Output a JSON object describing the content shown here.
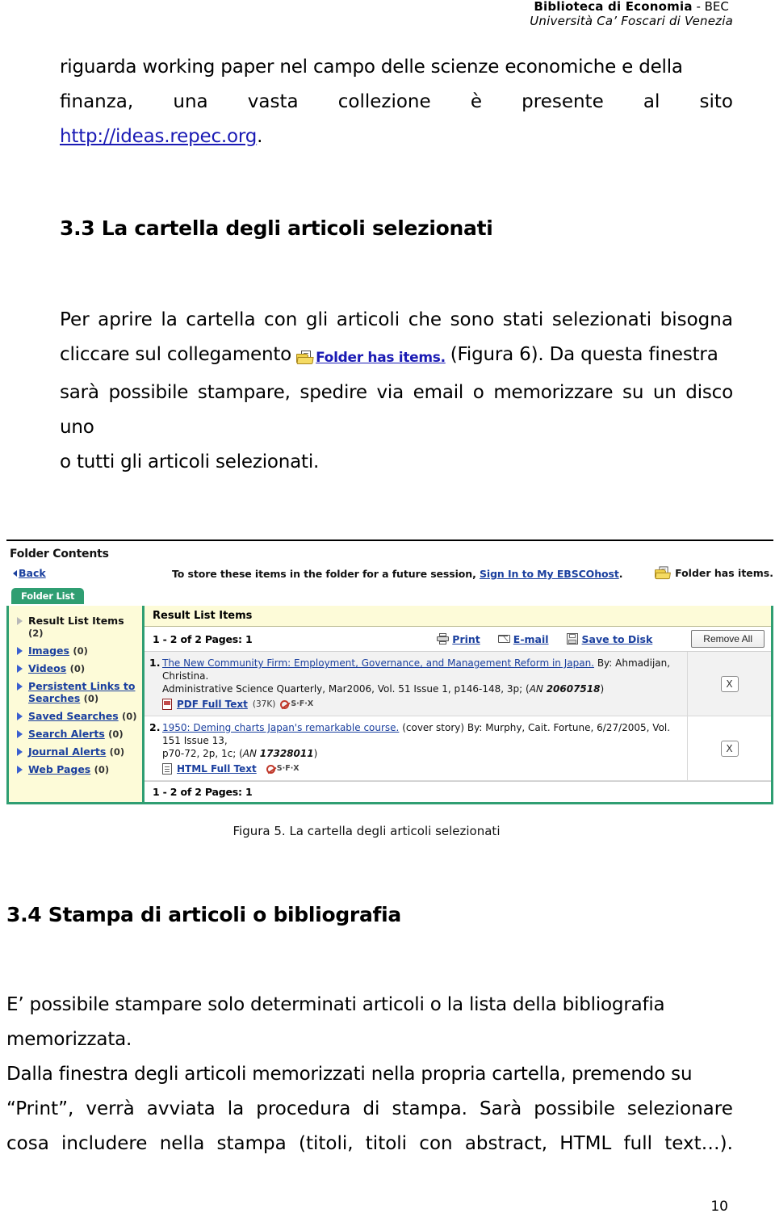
{
  "header": {
    "line1_bold": "Biblioteca di Economia",
    "line1_rest": " -  BEC",
    "line2": "Università Ca’ Foscari di Venezia"
  },
  "intro": {
    "line1": "riguarda working paper nel campo delle scienze economiche e della",
    "line2_words": [
      "finanza,",
      "una",
      "vasta",
      "collezione",
      "è",
      "presente",
      "al",
      "sito"
    ],
    "url_text": "http://ideas.repec.org",
    "url_period": "."
  },
  "section_33": {
    "heading": "3.3 La cartella degli articoli selezionati",
    "para1_before": "Per aprire la cartella con gli articoli che sono stati selezionati bisogna",
    "para1_words": [
      "Per",
      "aprire",
      "la",
      "cartella",
      "con",
      "gli",
      "articoli",
      "che",
      "sono",
      "stati",
      "selezionati",
      "bisogna"
    ],
    "para2_lead": "cliccare sul collegamento",
    "chip_label": "Folder has items.",
    "para2_tail": "(Figura 6). Da questa finestra",
    "para3": "sarà possibile stampare, spedire via email o memorizzare su un disco uno",
    "para4": "o tutti gli articoli selezionati."
  },
  "screenshot": {
    "title": "Folder Contents",
    "back_label": "Back",
    "store_note_prefix": "To store these items in the folder for a future session, ",
    "store_note_link": "Sign In to My EBSCOhost",
    "store_note_suffix": ".",
    "folder_has_items": "Folder has items.",
    "tab_label": "Folder List",
    "sidebar_items": [
      {
        "label": "Result List Items",
        "count": "(2)",
        "active": true
      },
      {
        "label": "Images",
        "count": "(0)",
        "active": false
      },
      {
        "label": "Videos",
        "count": "(0)",
        "active": false
      },
      {
        "label": "Persistent Links to Searches",
        "count": "(0)",
        "active": false
      },
      {
        "label": "Saved Searches",
        "count": "(0)",
        "active": false
      },
      {
        "label": "Search Alerts",
        "count": "(0)",
        "active": false
      },
      {
        "label": "Journal Alerts",
        "count": "(0)",
        "active": false
      },
      {
        "label": "Web Pages",
        "count": "(0)",
        "active": false
      }
    ],
    "panel_title": "Result List Items",
    "pager_top": "1 - 2 of 2  Pages: 1",
    "pager_bottom": "1 - 2 of 2  Pages: 1",
    "tool_print": "Print",
    "tool_email": "E-mail",
    "tool_save": "Save to Disk",
    "btn_remove_all": "Remove All",
    "records": [
      {
        "num": "1.",
        "title": "The New Community Firm: Employment, Governance, and Management Reform in Japan.",
        "author": "By: Ahmadijan, Christina.",
        "source": "Administrative Science Quarterly, Mar2006, Vol. 51 Issue 1, p146-148, 3p; (",
        "an_prefix": "AN ",
        "an_value": "20607518",
        "an_suffix": ")",
        "fulltext_label": "PDF Full Text",
        "fulltext_size": "(37K)",
        "sfx_label": "S·F·X",
        "remove_label": "X"
      },
      {
        "num": "2.",
        "title": "1950: Deming charts Japan's remarkable course.",
        "author": "(cover story) By: Murphy, Cait. Fortune, 6/27/2005, Vol. 151 Issue 13,",
        "source": "p70-72, 2p, 1c; (",
        "an_prefix": "AN ",
        "an_value": "17328011",
        "an_suffix": ")",
        "fulltext_label": "HTML Full Text",
        "fulltext_size": "",
        "sfx_label": "S·F·X",
        "remove_label": "X"
      }
    ]
  },
  "figure_caption": "Figura 5. La cartella degli articoli selezionati",
  "section_34": {
    "heading": "3.4 Stampa di articoli o bibliografia",
    "para1": "E’ possibile stampare solo determinati articoli o la lista della bibliografia",
    "para2": "memorizzata.",
    "para3": "Dalla finestra degli articoli memorizzati nella propria cartella, premendo su",
    "para4_words": [
      "“Print”,",
      "verrà",
      "avviata",
      "la",
      "procedura",
      "di",
      "stampa.",
      "Sarà",
      "possibile",
      "selezionare"
    ],
    "para5_words": [
      "cosa",
      "includere",
      "nella",
      "stampa",
      "(titoli,",
      "titoli",
      "con",
      "abstract,",
      "HTML",
      "full",
      "text…)."
    ]
  },
  "page_number": "10"
}
